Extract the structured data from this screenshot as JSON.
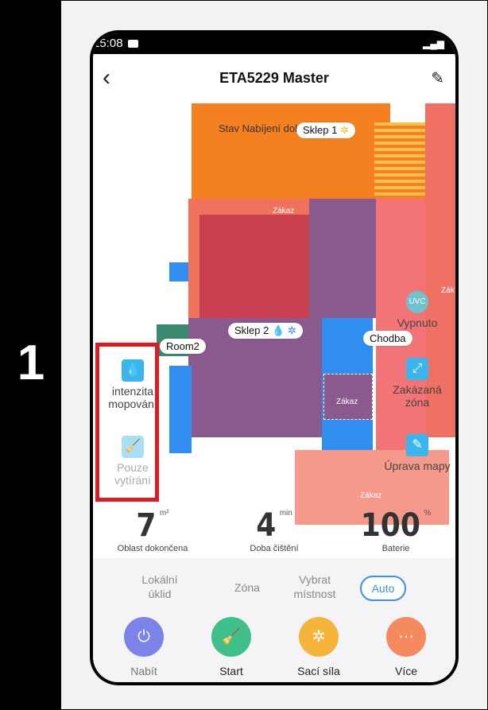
{
  "step": "1",
  "status": {
    "time": "15:08"
  },
  "header": {
    "title": "ETA5229 Master"
  },
  "map": {
    "status_text": "Stav Nabíjení dokončeno",
    "rooms": [
      {
        "name": "Sklep 1"
      },
      {
        "name": "Sklep 2"
      },
      {
        "name": "Room2"
      },
      {
        "name": "Chodba"
      }
    ],
    "zone_label": "Zákaz",
    "zak_short": "Zák"
  },
  "side_left": [
    {
      "label": "intenzita mopování",
      "icon": "water-drop-icon"
    },
    {
      "label": "Pouze vytírání",
      "icon": "mop-icon"
    }
  ],
  "side_right": [
    {
      "badge": "UVC",
      "label": "Vypnuto",
      "icon": "uvc-icon"
    },
    {
      "label": "Zakázaná zóna",
      "icon": "forbidden-zone-icon"
    },
    {
      "label": "Úprava mapy",
      "icon": "edit-map-icon"
    }
  ],
  "stats": [
    {
      "value": "7",
      "unit": "m²",
      "label": "Oblast dokončena"
    },
    {
      "value": "4",
      "unit": "min",
      "label": "Doba čištění"
    },
    {
      "value": "100",
      "unit": "%",
      "label": "Baterie"
    }
  ],
  "modes": [
    "Lokální úklid",
    "Zóna",
    "Vybrat místnost",
    "Auto"
  ],
  "actions": [
    {
      "label": "Nabít",
      "color": "#7b82e8",
      "icon": "charge-icon"
    },
    {
      "label": "Start",
      "color": "#3fc08a",
      "icon": "broom-icon"
    },
    {
      "label": "Sací síla",
      "color": "#f5b53a",
      "icon": "fan-icon"
    },
    {
      "label": "Více",
      "color": "#f48a5e",
      "icon": "more-icon"
    }
  ],
  "colors": {
    "highlight": "#e01a22",
    "accent": "#3b8ff0"
  }
}
